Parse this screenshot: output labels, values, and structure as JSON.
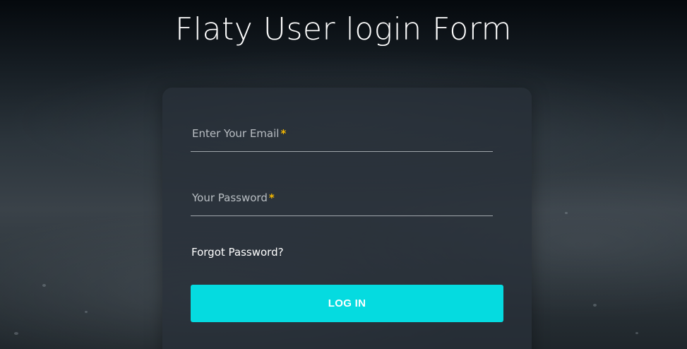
{
  "page": {
    "title": "Flaty User login Form"
  },
  "form": {
    "email_label": "Enter Your Email",
    "password_label": "Your Password",
    "required_mark": "*",
    "forgot_password": "Forgot Password?",
    "login_button": "LOG IN"
  },
  "colors": {
    "accent": "#05dbe0",
    "required": "#f5b800"
  }
}
